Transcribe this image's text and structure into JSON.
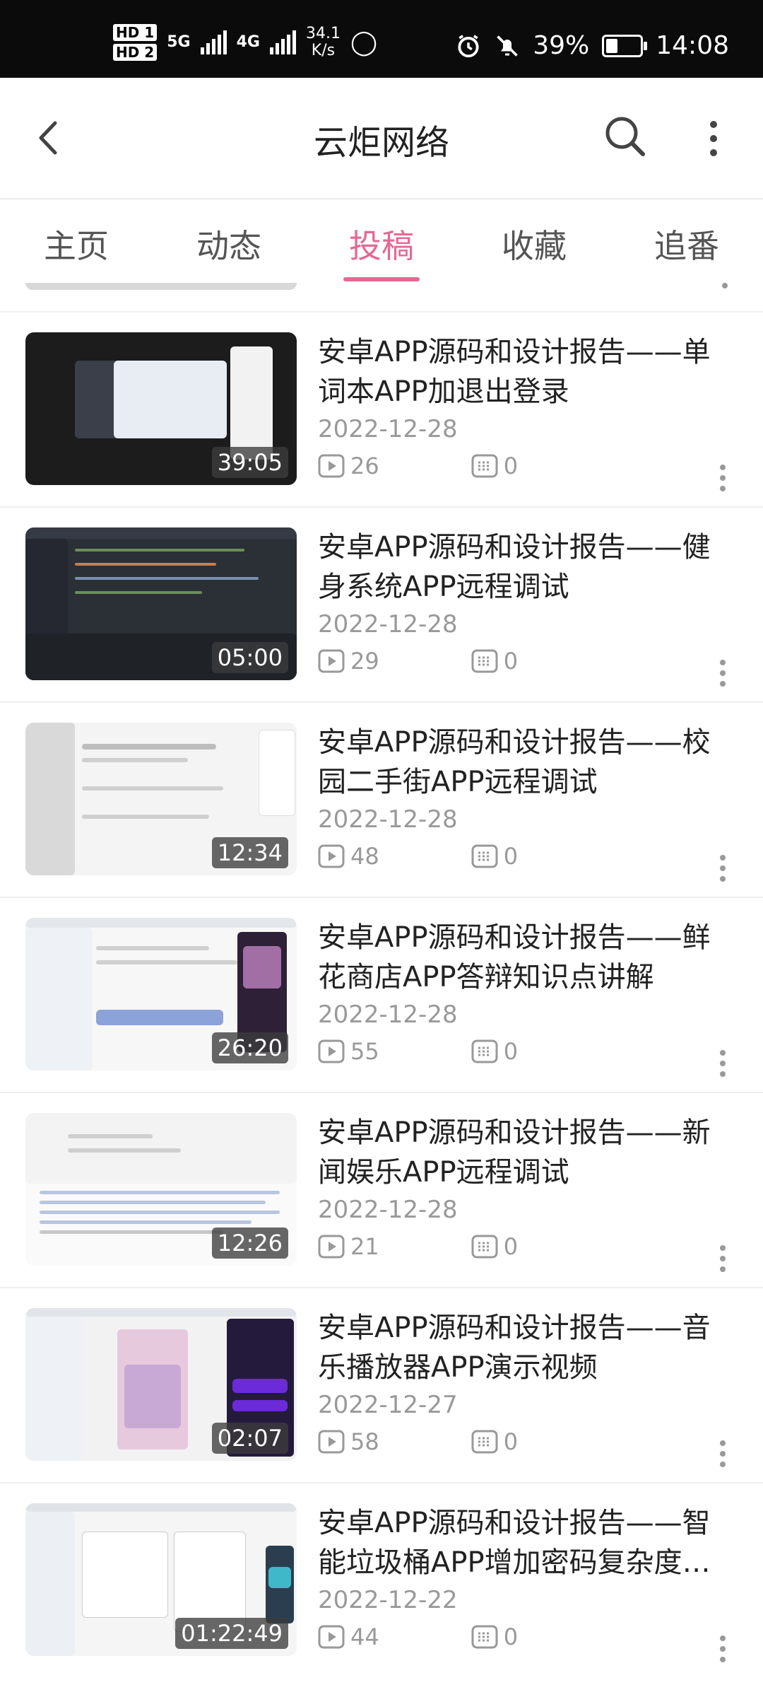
{
  "status_bar": {
    "hd1": "HD 1",
    "hd2": "HD 2",
    "net1": "5G",
    "net2": "4G",
    "speed_value": "34.1",
    "speed_unit": "K/s",
    "battery_percent": "39%",
    "time": "14:08",
    "icons": [
      "alarm-icon",
      "mute-icon",
      "battery-icon"
    ]
  },
  "header": {
    "title": "云炬网络",
    "icons": [
      "back-arrow-icon",
      "search-icon",
      "more-vertical-icon"
    ]
  },
  "tabs": [
    {
      "label": "主页",
      "active": false
    },
    {
      "label": "动态",
      "active": false
    },
    {
      "label": "投稿",
      "active": true
    },
    {
      "label": "收藏",
      "active": false
    },
    {
      "label": "追番",
      "active": false
    }
  ],
  "accent_color": "#e46a92",
  "videos": [
    {
      "title": "安卓APP源码和设计报告——单词本APP加退出登录",
      "date": "2022-12-28",
      "duration": "39:05",
      "views": "26",
      "comments": "0"
    },
    {
      "title": "安卓APP源码和设计报告——健身系统APP远程调试",
      "date": "2022-12-28",
      "duration": "05:00",
      "views": "29",
      "comments": "0"
    },
    {
      "title": "安卓APP源码和设计报告——校园二手街APP远程调试",
      "date": "2022-12-28",
      "duration": "12:34",
      "views": "48",
      "comments": "0"
    },
    {
      "title": "安卓APP源码和设计报告——鲜花商店APP答辩知识点讲解",
      "date": "2022-12-28",
      "duration": "26:20",
      "views": "55",
      "comments": "0"
    },
    {
      "title": "安卓APP源码和设计报告——新闻娱乐APP远程调试",
      "date": "2022-12-28",
      "duration": "12:26",
      "views": "21",
      "comments": "0"
    },
    {
      "title": "安卓APP源码和设计报告——音乐播放器APP演示视频",
      "date": "2022-12-27",
      "duration": "02:07",
      "views": "58",
      "comments": "0"
    },
    {
      "title": "安卓APP源码和设计报告——智能垃圾桶APP增加密码复杂度…",
      "date": "2022-12-22",
      "duration": "01:22:49",
      "views": "44",
      "comments": "0"
    }
  ]
}
